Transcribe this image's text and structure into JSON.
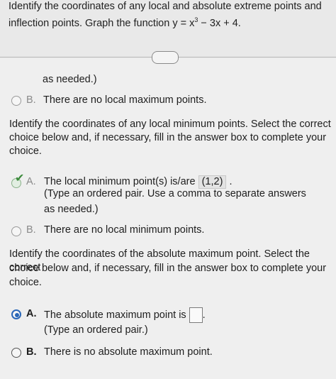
{
  "question": {
    "line1": "Identify the coordinates of any local and absolute extreme points and",
    "line2_prefix": "inflection points. Graph the function y = x",
    "exponent": "3",
    "line2_suffix": " − 3x + 4."
  },
  "more_button": "• • •",
  "section_max_local": {
    "continued_text": "as needed.)",
    "option_b": {
      "letter": "B.",
      "text": "There are no local maximum points."
    }
  },
  "section_min_local": {
    "prompt_lines": [
      "Identify the coordinates of any local minimum points. Select the correct",
      "choice below and, if necessary, fill in the answer box to complete your",
      "choice."
    ],
    "option_a": {
      "letter": "A.",
      "text": "The local minimum point(s) is/are",
      "value": "(1,2)",
      "trail": ".",
      "note_lines": [
        "(Type an ordered pair. Use a comma to separate answers",
        "as needed.)"
      ]
    },
    "option_b": {
      "letter": "B.",
      "text": "There are no local minimum points."
    }
  },
  "section_abs_max": {
    "prompt_lines": [
      "Identify the coordinates of the absolute maximum point. Select the correct",
      "choice below and, if necessary, fill in the answer box to complete your",
      "choice."
    ],
    "option_a": {
      "letter": "A.",
      "text": "The absolute maximum point is",
      "trail": ".",
      "note": "(Type an ordered pair.)"
    },
    "option_b": {
      "letter": "B.",
      "text": "There is no absolute maximum point."
    }
  }
}
